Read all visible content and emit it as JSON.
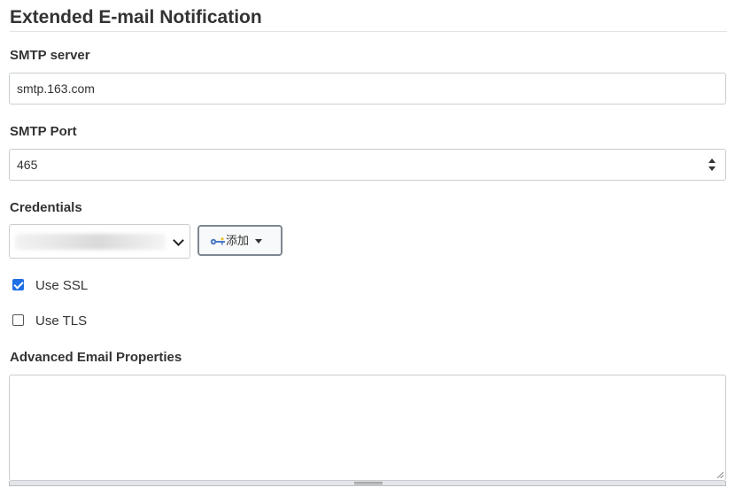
{
  "section": {
    "title": "Extended E-mail Notification"
  },
  "smtp_server": {
    "label": "SMTP server",
    "value": "smtp.163.com"
  },
  "smtp_port": {
    "label": "SMTP Port",
    "value": "465"
  },
  "credentials": {
    "label": "Credentials",
    "selected_value": "",
    "add_button": {
      "label": "添加",
      "icon": "key-icon"
    }
  },
  "use_ssl": {
    "label": "Use SSL",
    "checked": true
  },
  "use_tls": {
    "label": "Use TLS",
    "checked": false
  },
  "advanced_properties": {
    "label": "Advanced Email Properties",
    "value": ""
  },
  "colors": {
    "checkbox_accent": "#1f6fe5",
    "input_border": "#c9cdd1",
    "text": "#333333"
  }
}
